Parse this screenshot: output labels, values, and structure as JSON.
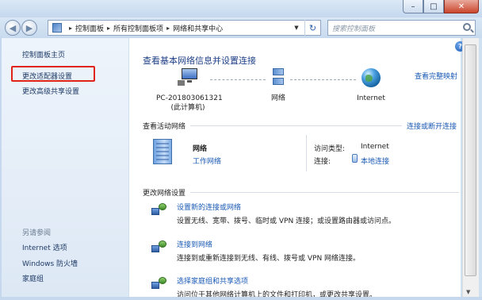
{
  "window": {
    "minimize_icon": "minimize-icon",
    "maximize_icon": "maximize-icon",
    "close_icon": "close-icon"
  },
  "address": {
    "breadcrumbs": [
      "控制面板",
      "所有控制面板项",
      "网络和共享中心"
    ],
    "search_placeholder": "搜索控制面板"
  },
  "sidebar": {
    "home": "控制面板主页",
    "adapter": "更改适配器设置",
    "advanced": "更改高级共享设置",
    "see_also": "另请参阅",
    "internet_options": "Internet 选项",
    "firewall": "Windows 防火墙",
    "homegroup": "家庭组"
  },
  "main": {
    "title": "查看基本网络信息并设置连接",
    "full_map": "查看完整映射",
    "nodes": {
      "pc_name": "PC-201803061321",
      "pc_sub": "(此计算机)",
      "network": "网络",
      "internet": "Internet"
    },
    "active_heading": "查看活动网络",
    "connect_link": "连接或断开连接",
    "network_name": "网络",
    "network_type": "工作网络",
    "access_type_label": "访问类型:",
    "access_type_value": "Internet",
    "connection_label": "连接:",
    "connection_value": "本地连接",
    "change_heading": "更改网络设置",
    "tasks": [
      {
        "title": "设置新的连接或网络",
        "desc": "设置无线、宽带、拨号、临时或 VPN 连接；或设置路由器或访问点。"
      },
      {
        "title": "连接到网络",
        "desc": "连接到或重新连接到无线、有线、拨号或 VPN 网络连接。"
      },
      {
        "title": "选择家庭组和共享选项",
        "desc": "访问位于其他网络计算机上的文件和打印机，或更改共享设置。"
      }
    ]
  },
  "colors": {
    "link": "#1a5ab4",
    "title": "#1d3f86",
    "highlight_box": "#e0241a"
  }
}
